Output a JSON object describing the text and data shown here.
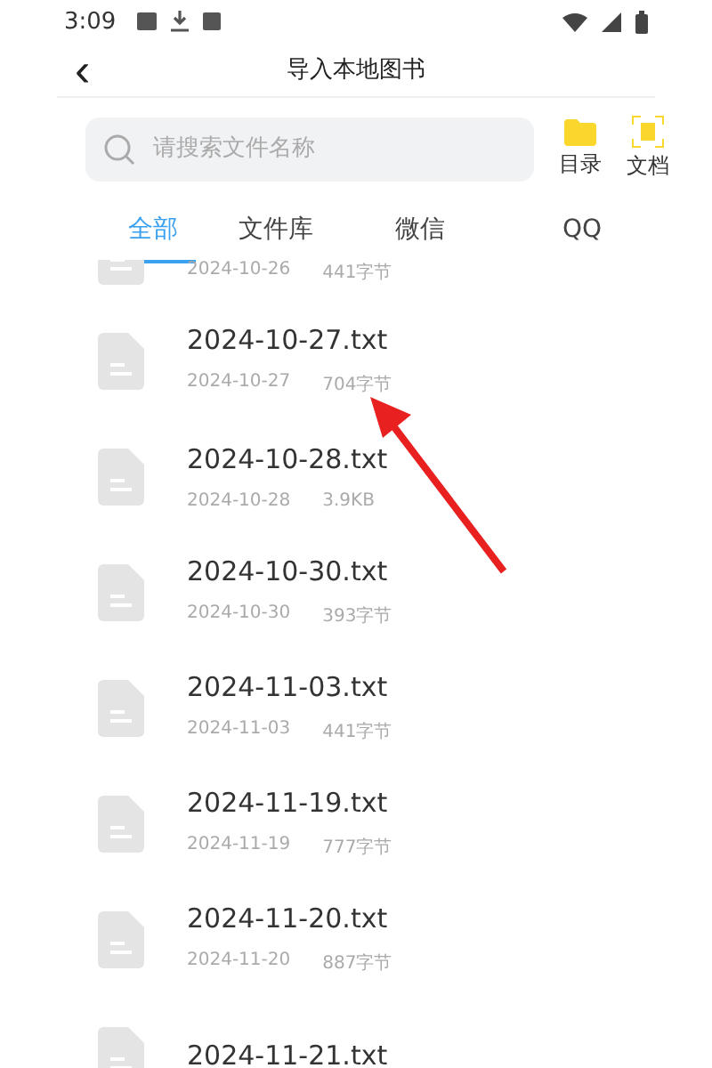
{
  "status_bar": {
    "time": "3:09"
  },
  "header": {
    "back": "‹",
    "title": "导入本地图书"
  },
  "search": {
    "placeholder": "请搜索文件名称"
  },
  "actions": [
    {
      "kind": "folder",
      "label": "目录"
    },
    {
      "kind": "scan",
      "label": "文档"
    }
  ],
  "tabs": [
    {
      "label": "全部",
      "selected": true
    },
    {
      "label": "文件库",
      "selected": false
    },
    {
      "label": "微信",
      "selected": false
    },
    {
      "label": "QQ",
      "selected": false
    }
  ],
  "files": [
    {
      "date": "2024-10-26",
      "size": "441字节"
    },
    {
      "name": "2024-10-27.txt",
      "date": "2024-10-27",
      "size": "704字节"
    },
    {
      "name": "2024-10-28.txt",
      "date": "2024-10-28",
      "size": "3.9KB"
    },
    {
      "name": "2024-10-30.txt",
      "date": "2024-10-30",
      "size": "393字节"
    },
    {
      "name": "2024-11-03.txt",
      "date": "2024-11-03",
      "size": "441字节"
    },
    {
      "name": "2024-11-19.txt",
      "date": "2024-11-19",
      "size": "777字节"
    },
    {
      "name": "2024-11-20.txt",
      "date": "2024-11-20",
      "size": "887字节"
    },
    {
      "name": "2024-11-21.txt"
    }
  ]
}
